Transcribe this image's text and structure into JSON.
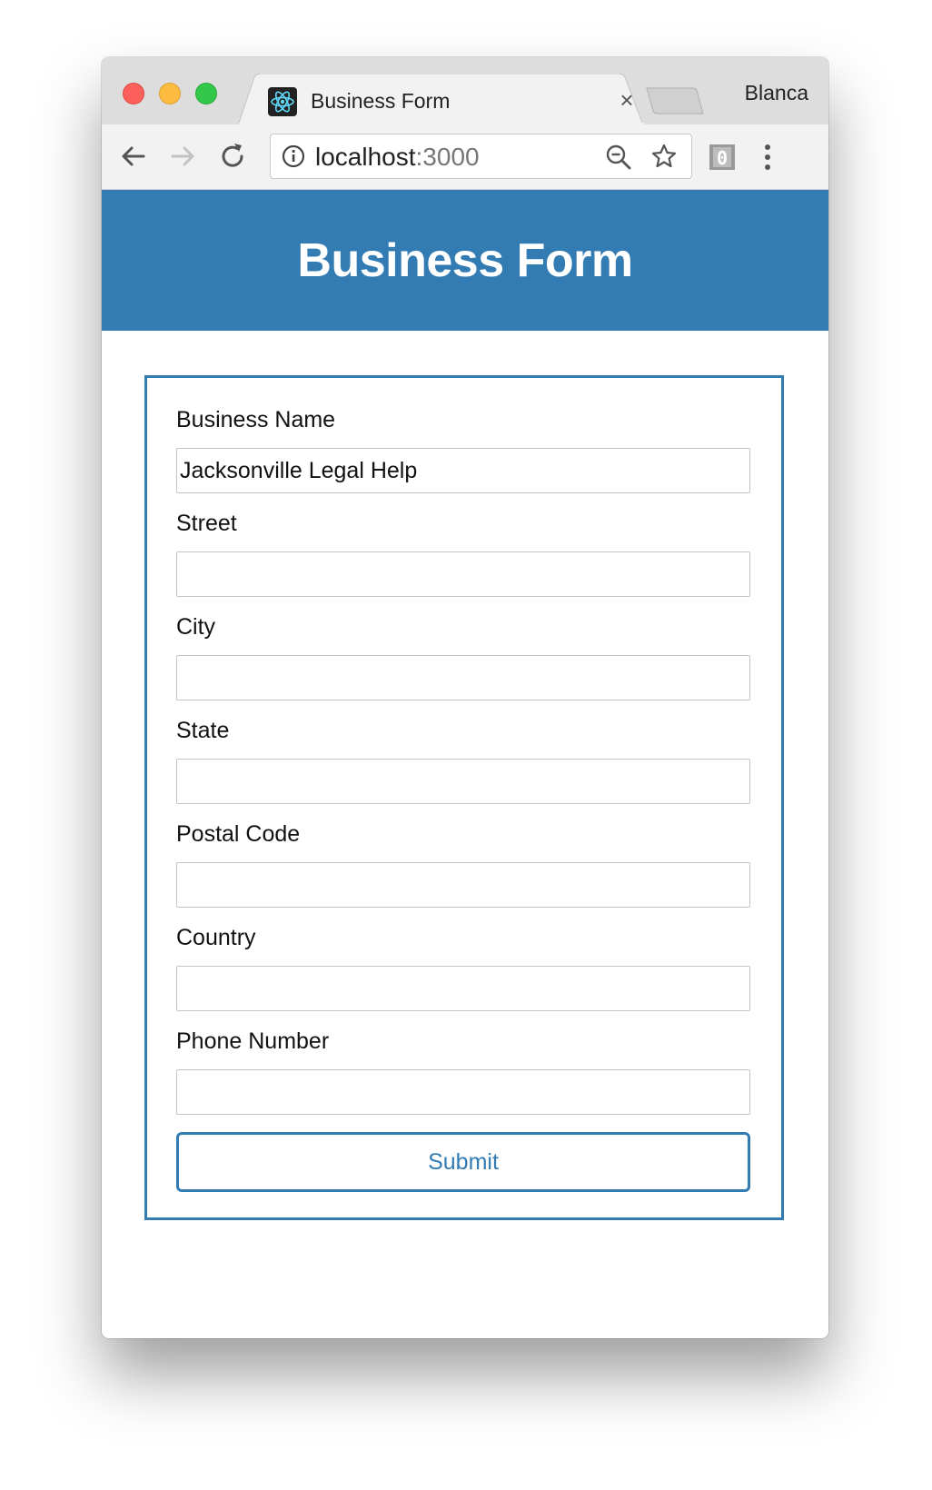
{
  "browser": {
    "tab": {
      "title": "Business Form",
      "close_glyph": "×",
      "favicon": "react-logo-icon"
    },
    "profile_name": "Blanca",
    "omnibox": {
      "host": "localhost",
      "port": ":3000"
    },
    "extension_glyph": "0",
    "icons": {
      "back": "arrow-left-icon",
      "forward": "arrow-right-icon",
      "reload": "reload-icon",
      "info": "info-icon",
      "zoom": "zoom-out-icon",
      "bookmark": "star-icon",
      "menu": "kebab-menu-icon"
    }
  },
  "app": {
    "title": "Business Form",
    "accent_color": "#327bb3",
    "form": {
      "fields": [
        {
          "label": "Business Name",
          "value": "Jacksonville Legal Help"
        },
        {
          "label": "Street",
          "value": ""
        },
        {
          "label": "City",
          "value": ""
        },
        {
          "label": "State",
          "value": ""
        },
        {
          "label": "Postal Code",
          "value": ""
        },
        {
          "label": "Country",
          "value": ""
        },
        {
          "label": "Phone Number",
          "value": ""
        }
      ],
      "submit_label": "Submit"
    }
  }
}
